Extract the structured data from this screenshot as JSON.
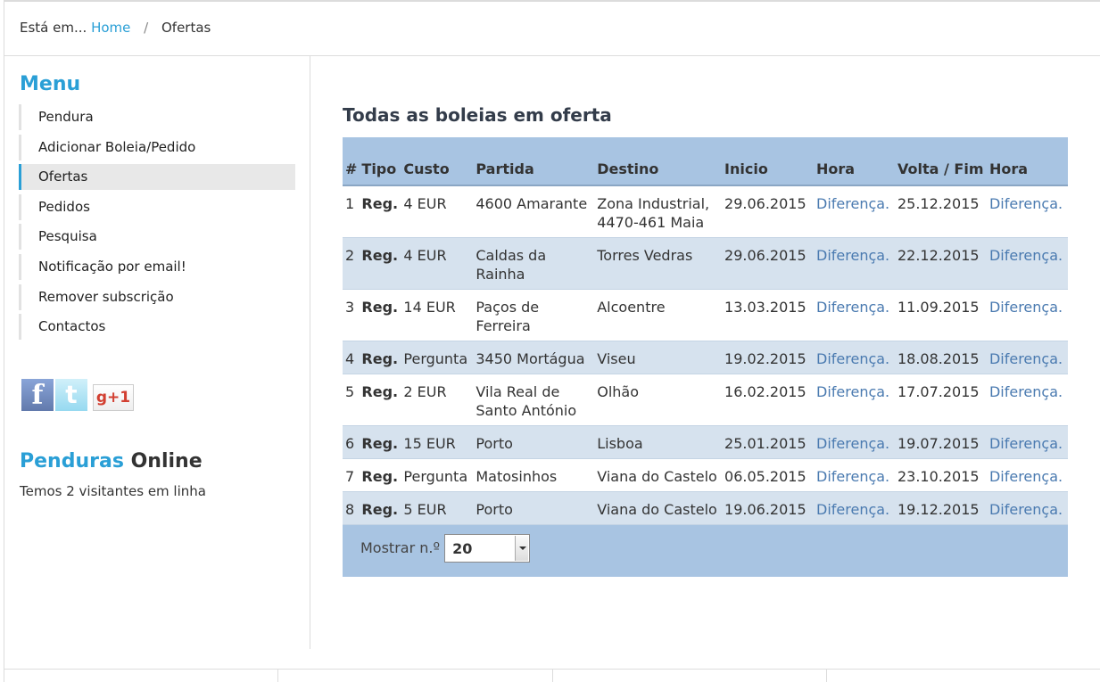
{
  "breadcrumb": {
    "prefix": "Está em...",
    "home": "Home",
    "separator": "/",
    "current": "Ofertas"
  },
  "sidebar": {
    "menu_title": "Menu",
    "items": [
      {
        "label": "Pendura",
        "active": false
      },
      {
        "label": "Adicionar Boleia/Pedido",
        "active": false
      },
      {
        "label": "Ofertas",
        "active": true
      },
      {
        "label": "Pedidos",
        "active": false
      },
      {
        "label": "Pesquisa",
        "active": false
      },
      {
        "label": "Notificação por email!",
        "active": false
      },
      {
        "label": "Remover subscrição",
        "active": false
      },
      {
        "label": "Contactos",
        "active": false
      }
    ],
    "social": {
      "facebook": "f",
      "twitter": "t",
      "gplus": "g+1"
    },
    "online": {
      "title_accent": "Penduras",
      "title_rest": "Online",
      "text": "Temos 2 visitantes em linha"
    }
  },
  "main": {
    "title": "Todas as boleias em oferta",
    "columns": [
      "#",
      "Tipo",
      "Custo",
      "Partida",
      "Destino",
      "Inicio",
      "Hora",
      "Volta / Fim",
      "Hora"
    ],
    "rows": [
      {
        "n": "1",
        "tipo": "Reg.",
        "custo": "4 EUR",
        "partida": "4600 Amarante",
        "destino": "Zona Industrial, 4470-461 Maia",
        "inicio": "29.06.2015",
        "hora": "Diferença.",
        "volta": "25.12.2015",
        "hora2": "Diferença."
      },
      {
        "n": "2",
        "tipo": "Reg.",
        "custo": "4 EUR",
        "partida": "Caldas da Rainha",
        "destino": "Torres Vedras",
        "inicio": "29.06.2015",
        "hora": "Diferença.",
        "volta": "22.12.2015",
        "hora2": "Diferença."
      },
      {
        "n": "3",
        "tipo": "Reg.",
        "custo": "14 EUR",
        "partida": "Paços de Ferreira",
        "destino": "Alcoentre",
        "inicio": "13.03.2015",
        "hora": "Diferença.",
        "volta": "11.09.2015",
        "hora2": "Diferença."
      },
      {
        "n": "4",
        "tipo": "Reg.",
        "custo": "Pergunta",
        "partida": "3450 Mortágua",
        "destino": "Viseu",
        "inicio": "19.02.2015",
        "hora": "Diferença.",
        "volta": "18.08.2015",
        "hora2": "Diferença."
      },
      {
        "n": "5",
        "tipo": "Reg.",
        "custo": "2 EUR",
        "partida": "Vila Real de Santo António",
        "destino": "Olhão",
        "inicio": "16.02.2015",
        "hora": "Diferença.",
        "volta": "17.07.2015",
        "hora2": "Diferença."
      },
      {
        "n": "6",
        "tipo": "Reg.",
        "custo": "15 EUR",
        "partida": "Porto",
        "destino": "Lisboa",
        "inicio": "25.01.2015",
        "hora": "Diferença.",
        "volta": "19.07.2015",
        "hora2": "Diferença."
      },
      {
        "n": "7",
        "tipo": "Reg.",
        "custo": "Pergunta",
        "partida": "Matosinhos",
        "destino": "Viana do Castelo",
        "inicio": "06.05.2015",
        "hora": "Diferença.",
        "volta": "23.10.2015",
        "hora2": "Diferença."
      },
      {
        "n": "8",
        "tipo": "Reg.",
        "custo": "5 EUR",
        "partida": "Porto",
        "destino": "Viana do Castelo",
        "inicio": "19.06.2015",
        "hora": "Diferença.",
        "volta": "19.12.2015",
        "hora2": "Diferença."
      }
    ],
    "footer": {
      "label": "Mostrar n.º",
      "select_value": "20"
    }
  }
}
